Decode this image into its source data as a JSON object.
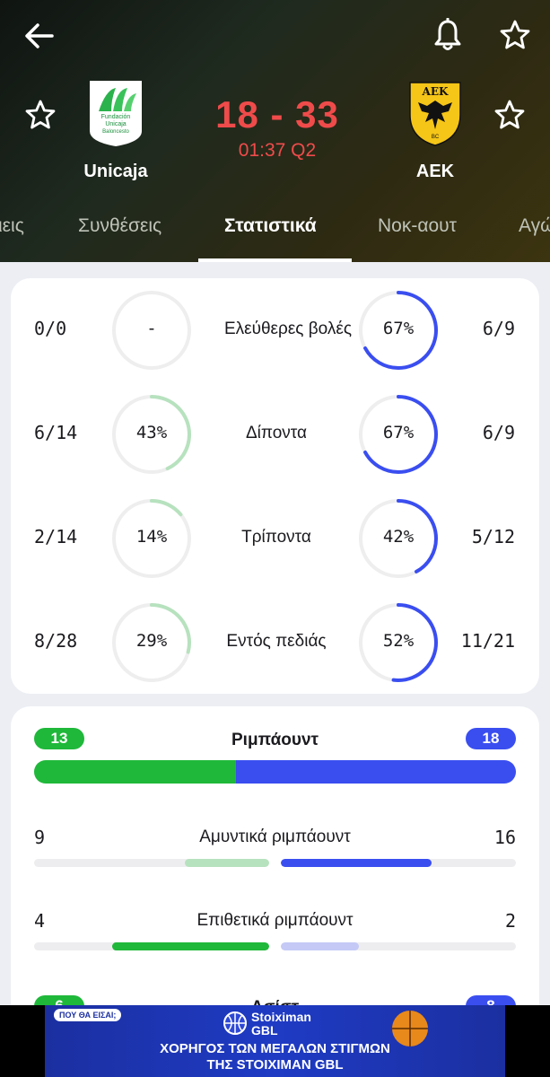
{
  "header": {
    "home_team": {
      "name": "Unicaja",
      "logo_text": [
        "Fundación",
        "Unicaja",
        "Baloncesto"
      ]
    },
    "away_team": {
      "name": "AEK",
      "logo_text": "ΑΕΚ",
      "logo_sub": "BC"
    },
    "score": "18 - 33",
    "clock": "01:37 Q2"
  },
  "tabs": [
    {
      "label": "ιεις"
    },
    {
      "label": "Συνθέσεις"
    },
    {
      "label": "Στατιστικά",
      "active": true
    },
    {
      "label": "Νοκ-αουτ"
    },
    {
      "label": "Αγώ"
    }
  ],
  "shooting": [
    {
      "label": "Ελεύθερες βολές",
      "home_value": "0/0",
      "home_pct": "-",
      "home_ratio": 0,
      "away_value": "6/9",
      "away_pct": "67%",
      "away_ratio": 0.67
    },
    {
      "label": "Δίποντα",
      "home_value": "6/14",
      "home_pct": "43%",
      "home_ratio": 0.43,
      "away_value": "6/9",
      "away_pct": "67%",
      "away_ratio": 0.67
    },
    {
      "label": "Τρίποντα",
      "home_value": "2/14",
      "home_pct": "14%",
      "home_ratio": 0.14,
      "away_value": "5/12",
      "away_pct": "42%",
      "away_ratio": 0.42
    },
    {
      "label": "Εντός πεδιάς",
      "home_value": "8/28",
      "home_pct": "29%",
      "home_ratio": 0.29,
      "away_value": "11/21",
      "away_pct": "52%",
      "away_ratio": 0.52
    }
  ],
  "rebounds": {
    "total": {
      "label": "Ριμπάουντ",
      "home": "13",
      "away": "18",
      "home_share": 0.419
    },
    "defensive": {
      "label": "Αμυντικά ριμπάουντ",
      "home": "9",
      "away": "16",
      "home_fill": 0.36,
      "away_fill": 0.64
    },
    "offensive": {
      "label": "Επιθετικά ριμπάουντ",
      "home": "4",
      "away": "2",
      "home_fill": 0.667,
      "away_fill": 0.333
    },
    "assists": {
      "label": "Ασίστ",
      "home": "6",
      "away": "8"
    }
  },
  "ad": {
    "bubble": "ΠΟΥ ΘΑ ΕΙΣΑΙ;",
    "brand_line1": "Stoiximan",
    "brand_line2": "GBL",
    "line1": "ΧΟΡΗΓΟΣ ΤΩΝ ΜΕΓΑΛΩΝ ΣΤΙΓΜΩΝ",
    "line2": "ΤΗΣ STOIXIMAN GBL"
  },
  "colors": {
    "home": "#1fb83a",
    "home_light": "#b7e2be",
    "away": "#3a4ef0",
    "away_light": "#c4c9f6",
    "score": "#ef4b4b"
  }
}
